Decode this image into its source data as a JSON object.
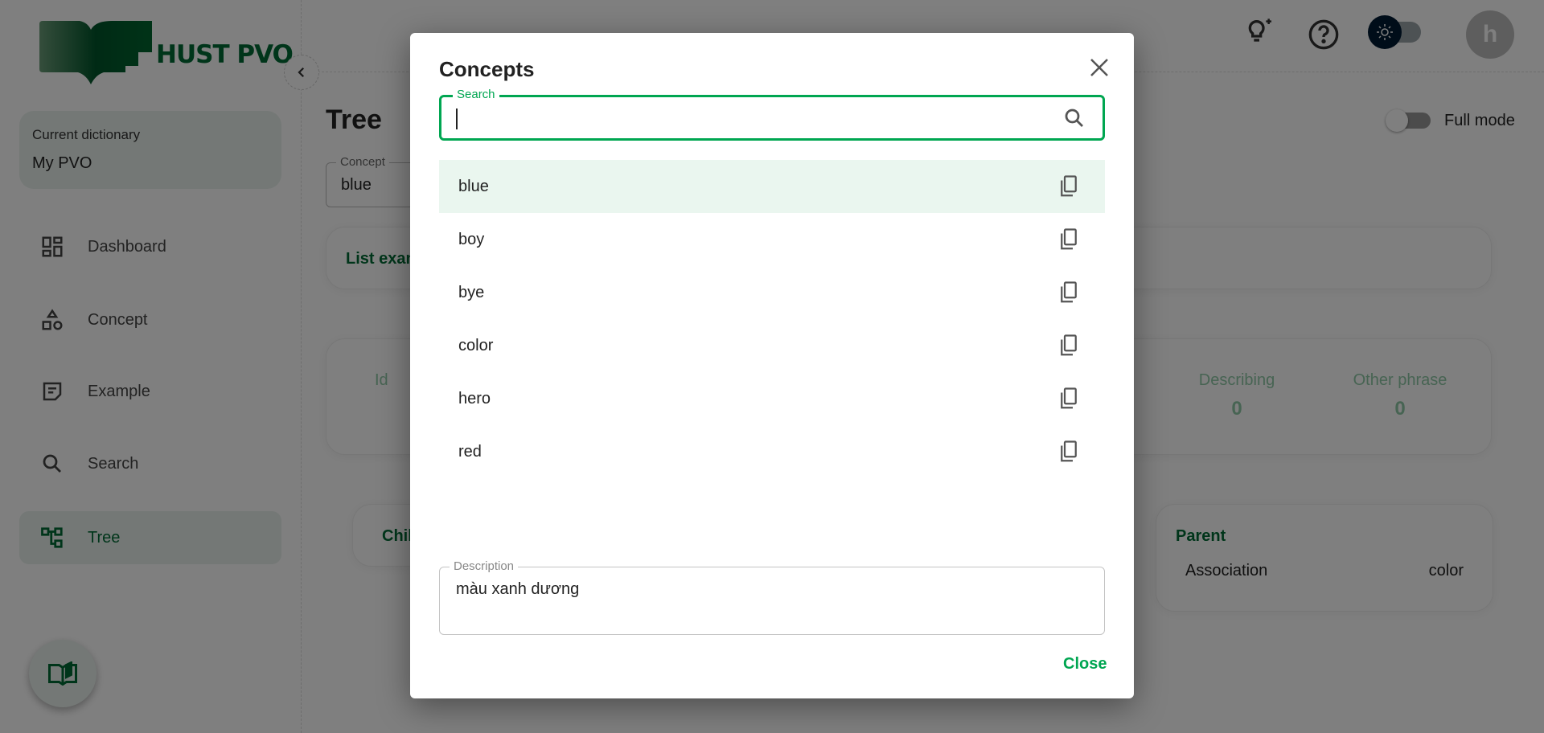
{
  "brand": {
    "name": "HUST PVO"
  },
  "sidebar": {
    "current_dictionary_label": "Current dictionary",
    "current_dictionary_value": "My PVO",
    "items": [
      {
        "label": "Dashboard",
        "icon": "dashboard-icon"
      },
      {
        "label": "Concept",
        "icon": "shapes-icon"
      },
      {
        "label": "Example",
        "icon": "note-icon"
      },
      {
        "label": "Search",
        "icon": "search-icon"
      },
      {
        "label": "Tree",
        "icon": "tree-icon",
        "active": true
      }
    ]
  },
  "header": {
    "avatar_letter": "h",
    "theme": "light"
  },
  "main": {
    "title": "Tree",
    "full_mode_label": "Full mode",
    "full_mode_on": false,
    "concept_label": "Concept",
    "concept_value": "blue",
    "list_examples_label": "List exam",
    "stats": [
      {
        "label": "Id",
        "value": ""
      },
      {
        "label": "Describing",
        "value": "0"
      },
      {
        "label": "Other phrase",
        "value": "0"
      }
    ],
    "child_label": "Chil",
    "parent": {
      "title": "Parent",
      "relation": "Association",
      "value": "color"
    }
  },
  "dialog": {
    "title": "Concepts",
    "search_label": "Search",
    "search_value": "",
    "items": [
      "blue",
      "boy",
      "bye",
      "color",
      "hero",
      "red"
    ],
    "selected": "blue",
    "description_label": "Description",
    "description_value": "màu xanh dương",
    "close_label": "Close"
  },
  "colors": {
    "accent": "#00a651",
    "brand": "#006b35",
    "selected_bg": "#eaf6ef"
  }
}
